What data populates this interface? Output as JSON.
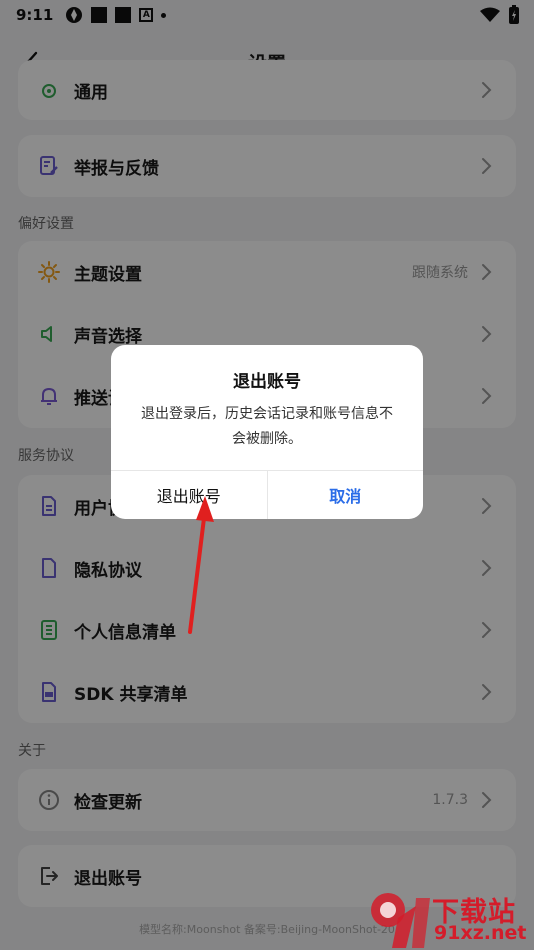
{
  "status_bar": {
    "time": "9:11"
  },
  "nav": {
    "title": "设置"
  },
  "rows": {
    "general": {
      "label": "通用"
    },
    "report": {
      "label": "举报与反馈"
    },
    "theme": {
      "label": "主题设置",
      "value": "跟随系统"
    },
    "sound": {
      "label": "声音选择"
    },
    "push": {
      "label": "推送设置"
    },
    "user_agreement": {
      "label": "用户协议"
    },
    "privacy": {
      "label": "隐私协议"
    },
    "personal_info": {
      "label": "个人信息清单"
    },
    "sdk": {
      "label": "SDK 共享清单"
    },
    "update": {
      "label": "检查更新",
      "value": "1.7.3"
    },
    "logout": {
      "label": "退出账号"
    }
  },
  "sections": {
    "preferences": "偏好设置",
    "service": "服务协议",
    "about": "关于"
  },
  "footer": {
    "text": "模型名称:Moonshot   备案号:Beijing-MoonShot-20"
  },
  "dialog": {
    "title": "退出账号",
    "message": "退出登录后，历史会话记录和账号信息不会被删除。",
    "confirm_label": "退出账号",
    "cancel_label": "取消"
  },
  "watermark": {
    "top": "下载站",
    "bottom": "91xz.net"
  },
  "colors": {
    "accent": "#2b6de8",
    "arrow": "#e0201f",
    "watermark": "#d41c2a",
    "theme_icon": "#f0a020",
    "sound_icon": "#3aaa55",
    "bell_icon": "#7b5cd6",
    "doc_icon": "#6b5ecf",
    "list_icon": "#3aaa55",
    "update_icon": "#888888"
  }
}
